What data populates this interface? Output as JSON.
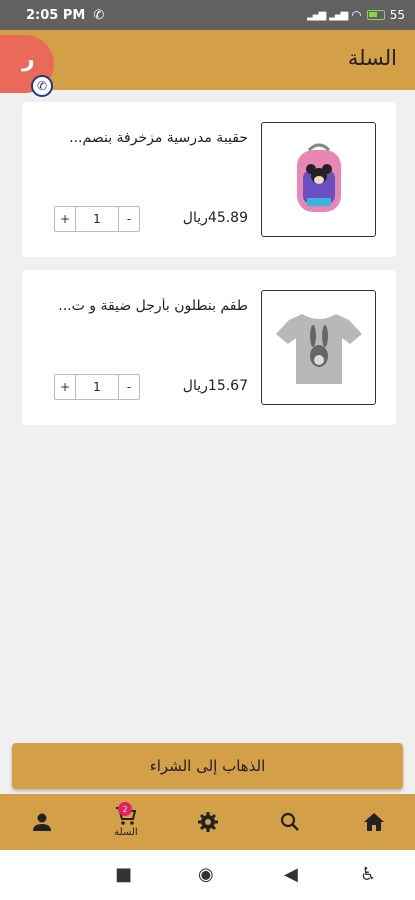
{
  "status": {
    "time": "2:05 PM",
    "battery": "55"
  },
  "app_bar": {
    "title": "السلة"
  },
  "fab": {
    "letter": "ر"
  },
  "cart": {
    "items": [
      {
        "title": "حقيبة مدرسية مزخرفة بنصم...",
        "price": "45.89ريال",
        "quantity": "1",
        "plus": "+",
        "minus": "-"
      },
      {
        "title": "طقم بنطلون بأرجل ضيقة و ت...",
        "price": "15.67ريال",
        "quantity": "1",
        "plus": "+",
        "minus": "-"
      }
    ]
  },
  "checkout": {
    "label": "الذهاب إلى الشراء"
  },
  "bottom_nav": {
    "items": [
      {
        "icon": "home-icon"
      },
      {
        "icon": "search-icon"
      },
      {
        "icon": "gear-icon"
      },
      {
        "icon": "cart-icon",
        "label": "السلة",
        "badge": "2"
      },
      {
        "icon": "person-icon"
      }
    ]
  },
  "colors": {
    "accent": "#d4a047",
    "fab": "#ea6a5a",
    "badge": "#e91e63"
  }
}
